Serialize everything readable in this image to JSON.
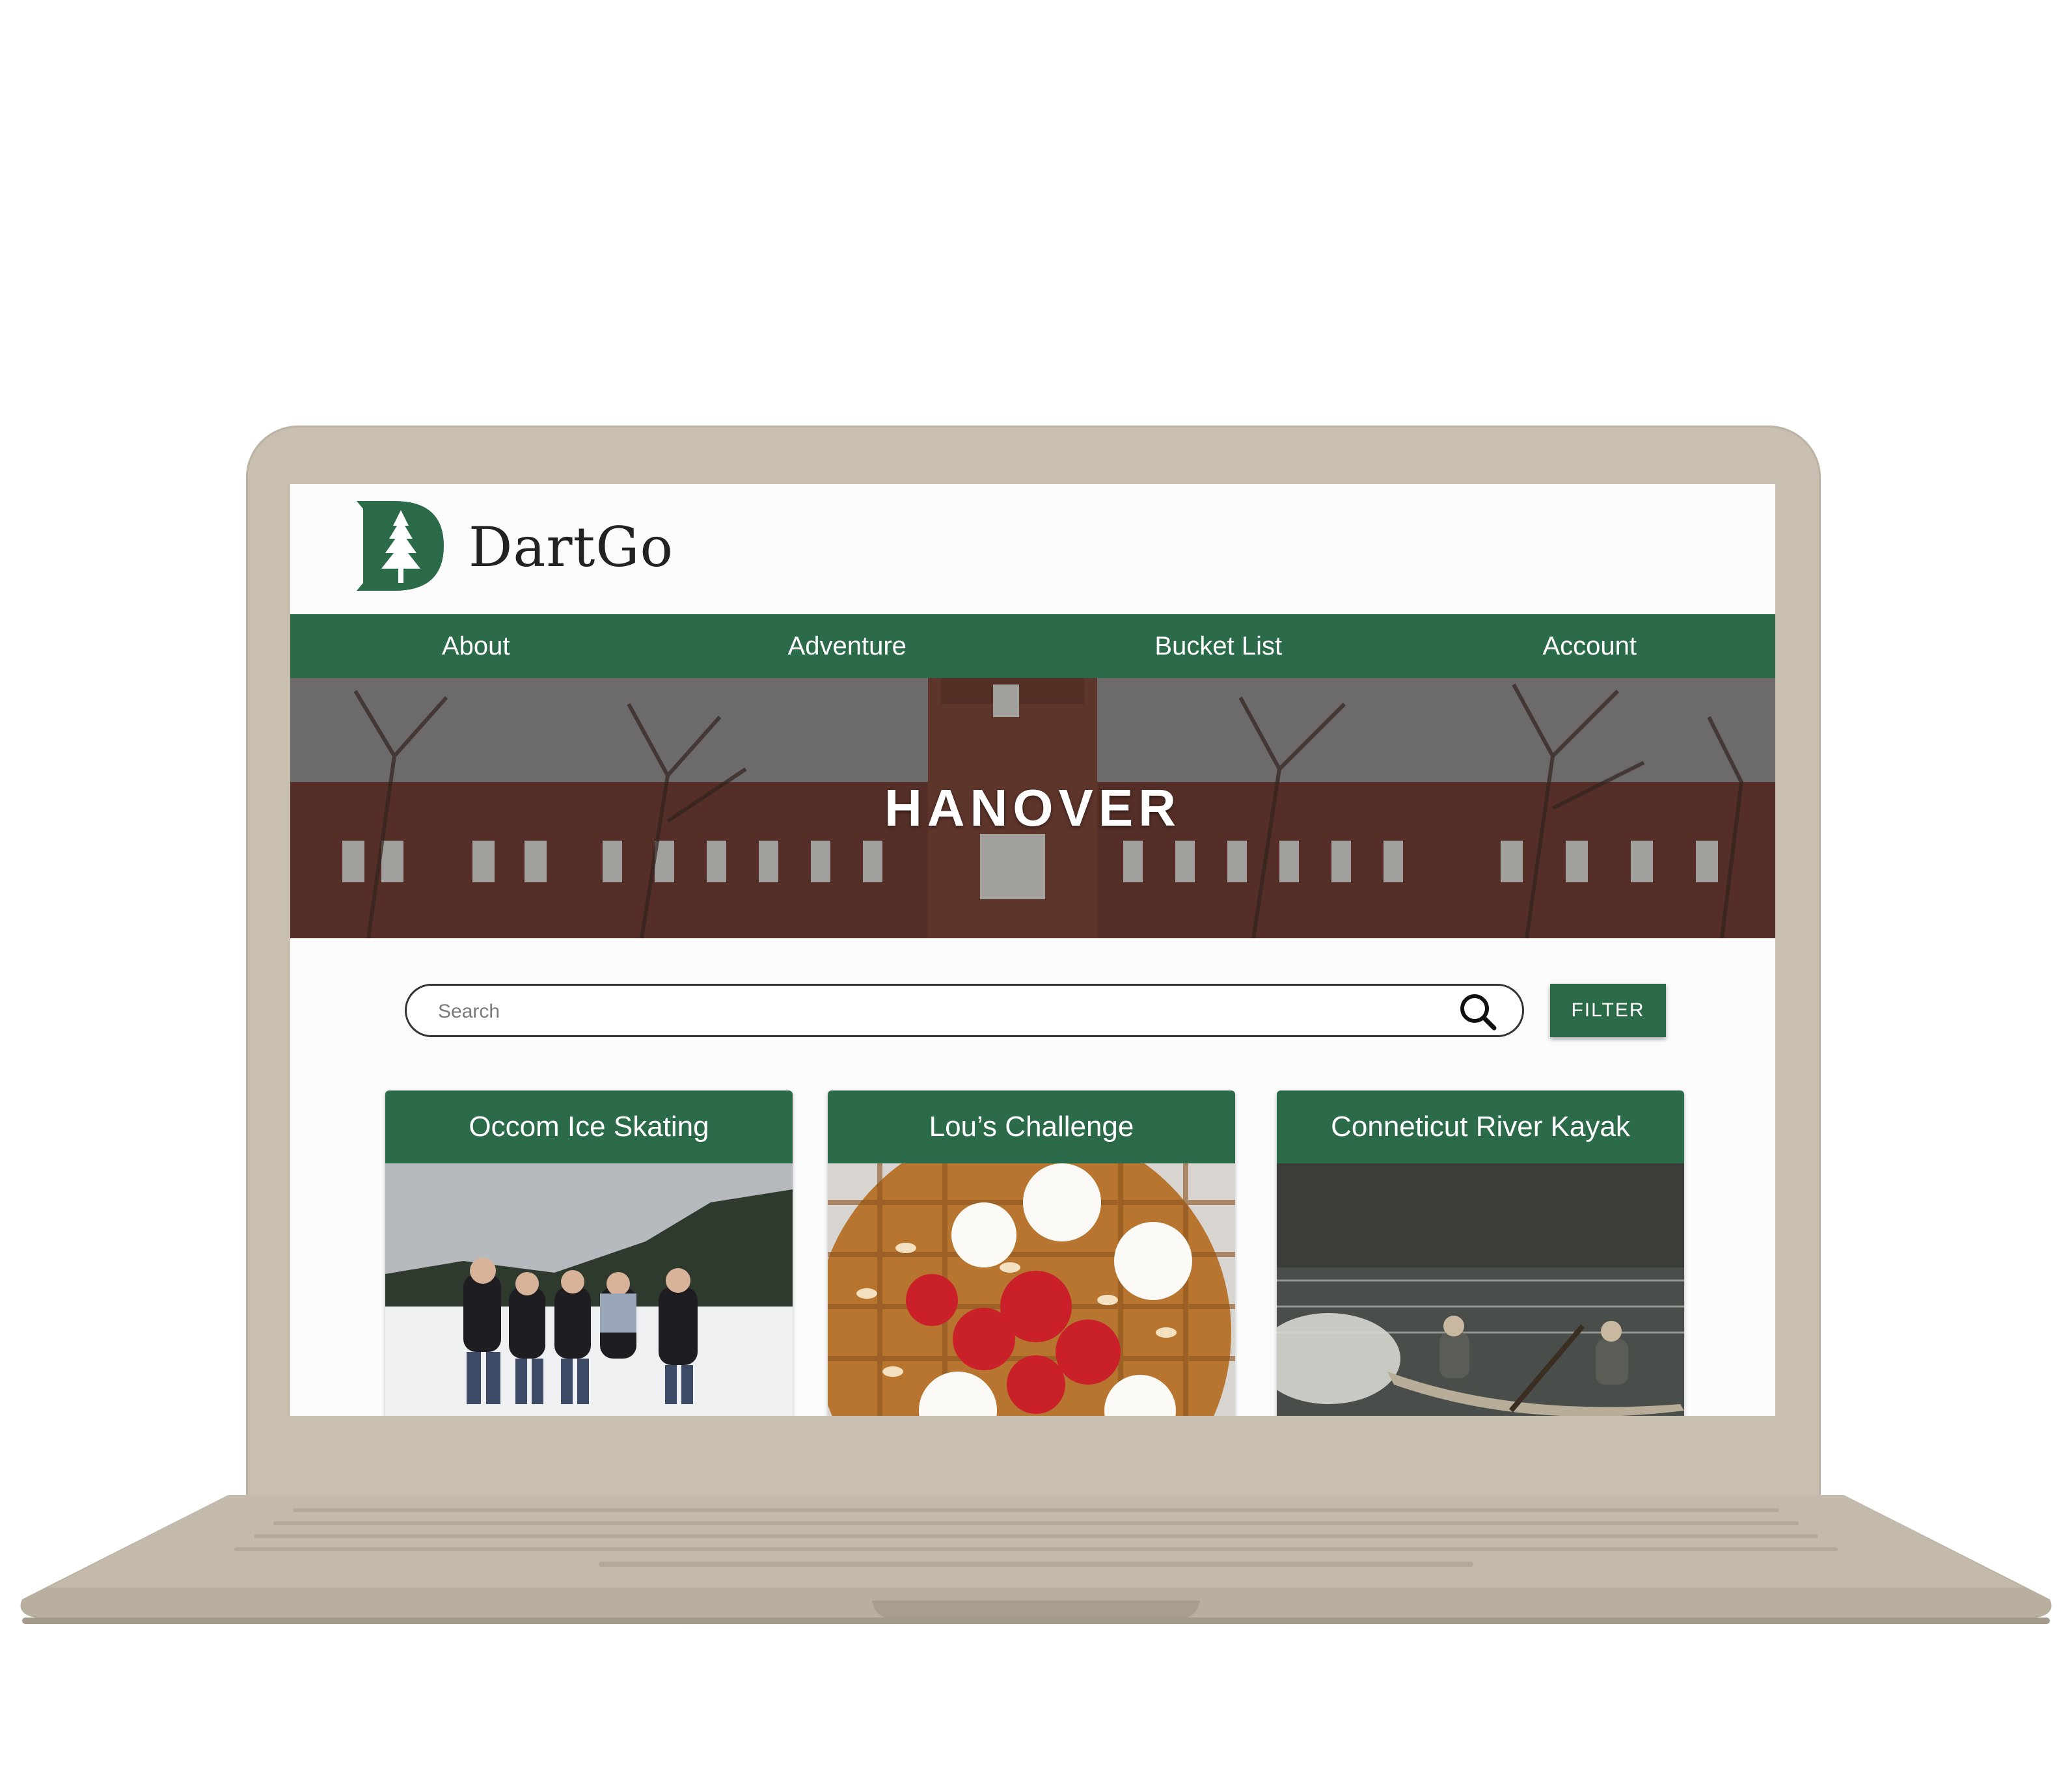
{
  "brand": {
    "name": "DartGo"
  },
  "nav": {
    "items": [
      "About",
      "Adventure",
      "Bucket List",
      "Account"
    ]
  },
  "hero": {
    "title": "HANOVER"
  },
  "search": {
    "placeholder": "Search"
  },
  "filter": {
    "label": "FILTER"
  },
  "cards": [
    {
      "title": "Occom Ice Skating",
      "image": "group-ice-skating-photo"
    },
    {
      "title": "Lou’s Challenge",
      "image": "waffle-strawberries-photo"
    },
    {
      "title": "Conneticut River Kayak",
      "image": "river-canoe-photo"
    }
  ],
  "colors": {
    "brand_green": "#2c6b4a",
    "laptop": "#c8bfb1"
  }
}
